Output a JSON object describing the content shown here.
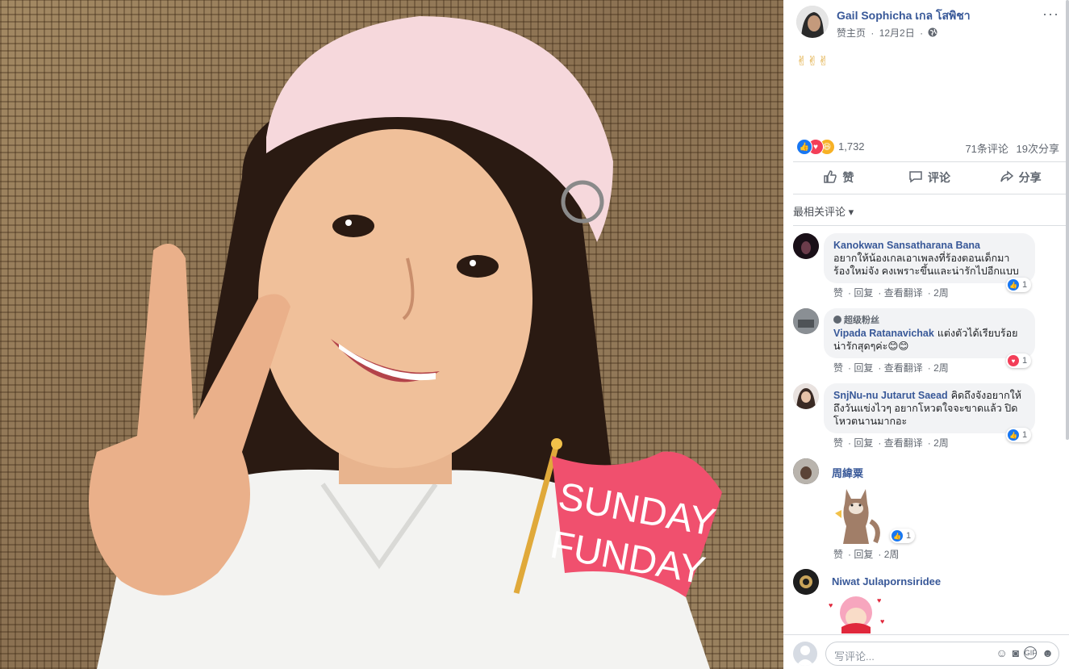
{
  "photo": {
    "sticker_line1": "SUNDAY",
    "sticker_line2": "FUNDAY",
    "sticker_color": "#f0506e"
  },
  "post": {
    "author": "Gail Sophicha เกล โสพิชา",
    "meta_like_page": "赞主页",
    "meta_dot": "·",
    "meta_date": "12月2日",
    "meta_dot2": "·",
    "privacy_icon": "globe-icon",
    "more": "···",
    "text": "✌✌✌",
    "reaction_count": "1,732",
    "comments_count": "71条评论",
    "shares_count": "19次分享"
  },
  "actions": {
    "like": "赞",
    "comment": "评论",
    "share": "分享"
  },
  "sort_label": "最相关评论 ▾",
  "comments": [
    {
      "name": "Kanokwan Sansatharana Bana",
      "text": "อยากให้น้องเกลเอาเพลงที่ร้องตอนเด็กมาร้องใหม่จัง คงเพราะขึ้นและน่ารักไปอีกแบบ",
      "like": "赞",
      "reply": "回复",
      "translate": "查看翻译",
      "time": "2周",
      "react_count": "1",
      "react_type": "like"
    },
    {
      "badge": "超级粉丝",
      "name": "Vipada Ratanavichak",
      "text": "แต่งตัวได้เรียบร้อย น่ารักสุดๆค่ะ😊😊",
      "like": "赞",
      "reply": "回复",
      "translate": "查看翻译",
      "time": "2周",
      "react_count": "1",
      "react_type": "love"
    },
    {
      "name": "SnjNu-nu Jutarut Saead",
      "text": "คิดถึงจังอยากให้ถึงวันแข่งไวๆ อยากโหวตใจจะขาดแล้ว ปิดโหวตนานมากอะ",
      "like": "赞",
      "reply": "回复",
      "translate": "查看翻译",
      "time": "2周",
      "react_count": "1",
      "react_type": "like"
    },
    {
      "name": "周緯粟",
      "like": "赞",
      "reply": "回复",
      "time": "2周",
      "react_count": "1",
      "react_type": "like"
    },
    {
      "name": "Niwat Julapornsiridee"
    }
  ],
  "composer": {
    "placeholder": "写评论..."
  },
  "colors": {
    "link": "#385898",
    "like_blue": "#1877f2",
    "love_red": "#f33e58",
    "haha_yellow": "#f7b125"
  }
}
